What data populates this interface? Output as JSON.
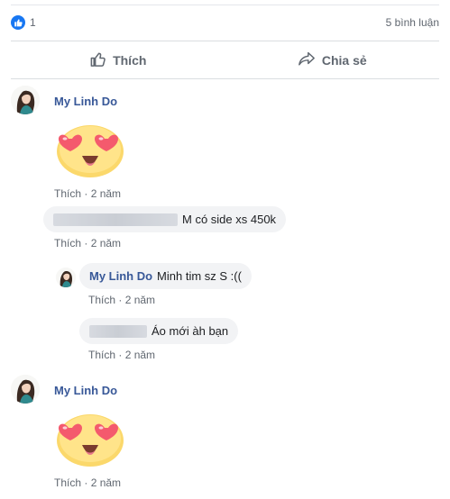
{
  "summary": {
    "like_count": "1",
    "comment_count": "5 bình luận"
  },
  "actions": {
    "like_label": "Thích",
    "share_label": "Chia sẻ"
  },
  "comments": [
    {
      "author": "My Linh Do",
      "sticker": "heart-eyes-emoji",
      "like_label": "Thích",
      "time": "2 năm"
    },
    {
      "text": "M có side xs 450k",
      "like_label": "Thích",
      "time": "2 năm"
    },
    {
      "author": "My Linh Do",
      "text": "Minh tim sz S :((",
      "like_label": "Thích",
      "time": "2 năm"
    },
    {
      "text": "Áo mới àh bạn",
      "like_label": "Thích",
      "time": "2 năm"
    },
    {
      "author": "My Linh Do",
      "sticker": "heart-eyes-emoji",
      "like_label": "Thích",
      "time": "2 năm"
    }
  ],
  "separator": "·",
  "colors": {
    "accent": "#1877f2",
    "author": "#385898",
    "muted": "#606770",
    "bubble": "#f2f3f5"
  }
}
